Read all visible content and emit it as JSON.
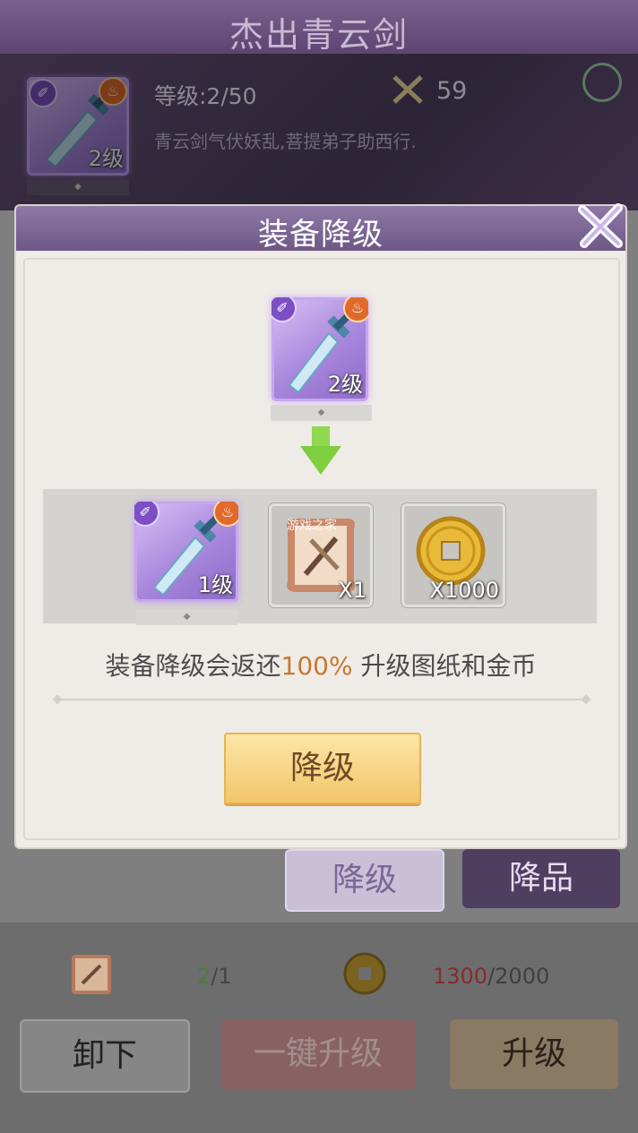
{
  "background": {
    "title": "杰出青云剑",
    "item_level_badge": "2级",
    "level_text": "等级:2/50",
    "power_value": "59",
    "description": "青云剑气伏妖乱,菩提弟子助西行.",
    "btn_downgrade": "降级",
    "btn_degrade_quality": "降品",
    "scroll_have": "2",
    "scroll_sep_need": "/1",
    "coin_have": "1300",
    "coin_sep_need": "/2000",
    "btn_unload": "卸下",
    "btn_oneclick_upgrade": "一键升级",
    "btn_upgrade": "升级"
  },
  "dialog": {
    "title": "装备降级",
    "current_item_level": "2级",
    "rewards": [
      {
        "name": "sword",
        "label": "1级"
      },
      {
        "name": "upgrade-scroll",
        "label": "X1"
      },
      {
        "name": "gold-coin",
        "label": "X1000"
      }
    ],
    "notice_before": "装备降级会返还",
    "notice_pct": "100%",
    "notice_after": " 升级图纸和金币",
    "confirm_label": "降级",
    "watermark": "游戏之家"
  },
  "colors": {
    "accent_purple": "#8f78a6",
    "highlight_orange": "#c6792f",
    "confirm_gold": "#f2c56b",
    "arrow_green": "#7fce3f"
  }
}
